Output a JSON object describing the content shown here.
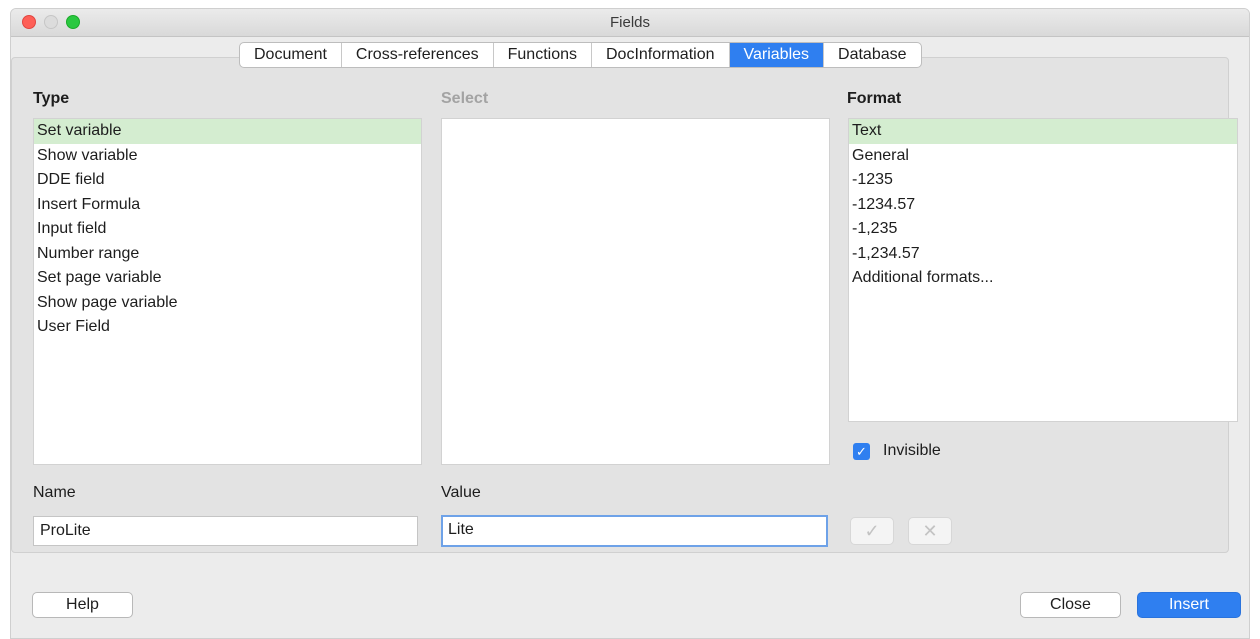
{
  "window": {
    "title": "Fields"
  },
  "tabs": [
    {
      "label": "Document"
    },
    {
      "label": "Cross-references"
    },
    {
      "label": "Functions"
    },
    {
      "label": "DocInformation"
    },
    {
      "label": "Variables",
      "active": true
    },
    {
      "label": "Database"
    }
  ],
  "type_column": {
    "label": "Type",
    "selected": "Set variable",
    "items": [
      "Set variable",
      "Show variable",
      "DDE field",
      "Insert Formula",
      "Input field",
      "Number range",
      "Set page variable",
      "Show page variable",
      "User Field"
    ]
  },
  "select_column": {
    "label": "Select",
    "items": []
  },
  "format_column": {
    "label": "Format",
    "selected": "Text",
    "items": [
      "Text",
      "General",
      "-1235",
      "-1234.57",
      "-1,235",
      "-1,234.57",
      "Additional formats..."
    ]
  },
  "invisible": {
    "label": "Invisible",
    "checked": true
  },
  "name_field": {
    "label": "Name",
    "value": "ProLite"
  },
  "value_field": {
    "label": "Value",
    "value": "Lite"
  },
  "icons": {
    "apply": "checkmark-icon",
    "delete": "close-icon"
  },
  "buttons": {
    "help": "Help",
    "close": "Close",
    "insert": "Insert"
  },
  "colors": {
    "accent": "#2f7ff0",
    "selection": "#d4edd0"
  }
}
